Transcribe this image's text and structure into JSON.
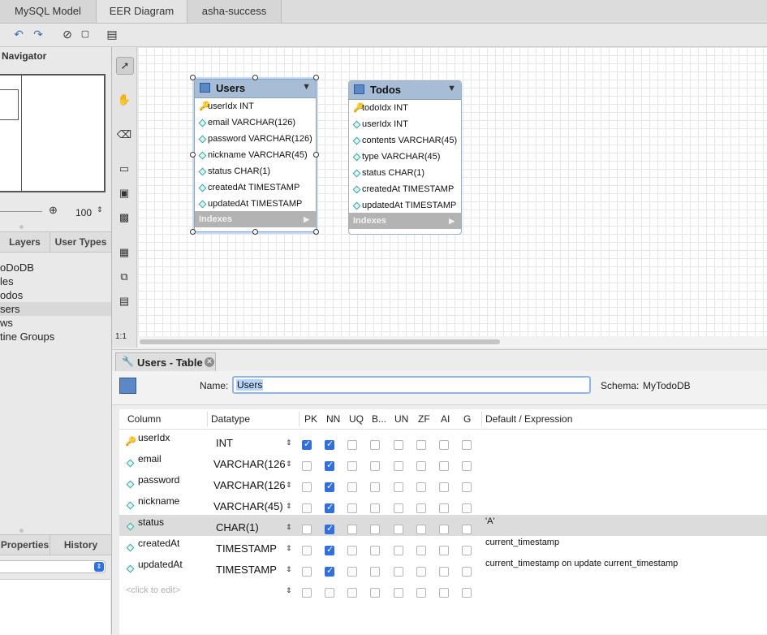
{
  "tabs": [
    "MySQL Model",
    "EER Diagram",
    "asha-success"
  ],
  "navigator": {
    "title": "Navigator",
    "zoom_value": "100"
  },
  "layer_tabs": [
    "Layers",
    "User Types"
  ],
  "tree_items": [
    "oDoDB",
    "les",
    "odos",
    "sers",
    "ws",
    "tine Groups"
  ],
  "bottom_tabs": [
    "Properties",
    "History"
  ],
  "zoom_ratio": "1:1",
  "entities": [
    {
      "name": "Users",
      "rows": [
        "userIdx INT",
        "email VARCHAR(126)",
        "password VARCHAR(126)",
        "nickname VARCHAR(45)",
        "status CHAR(1)",
        "createdAt TIMESTAMP",
        "updatedAt TIMESTAMP"
      ],
      "footer": "Indexes"
    },
    {
      "name": "Todos",
      "rows": [
        "todoIdx INT",
        "userIdx INT",
        "contents VARCHAR(45)",
        "type VARCHAR(45)",
        "status CHAR(1)",
        "createdAt TIMESTAMP",
        "updatedAt TIMESTAMP"
      ],
      "footer": "Indexes"
    }
  ],
  "editor": {
    "tab_title": "Users - Table",
    "name_label": "Name:",
    "name_value": "Users",
    "schema_label": "Schema:",
    "schema_value": "MyTodoDB"
  },
  "grid": {
    "headers": [
      "Column",
      "Datatype",
      "PK",
      "NN",
      "UQ",
      "B...",
      "UN",
      "ZF",
      "AI",
      "G",
      "Default / Expression"
    ],
    "rows": [
      {
        "name": "userIdx",
        "type": "INT",
        "default": "",
        "pk": true,
        "nn": true
      },
      {
        "name": "email",
        "type": "VARCHAR(126",
        "default": "",
        "pk": false,
        "nn": true
      },
      {
        "name": "password",
        "type": "VARCHAR(126",
        "default": "",
        "pk": false,
        "nn": true
      },
      {
        "name": "nickname",
        "type": "VARCHAR(45)",
        "default": "",
        "pk": false,
        "nn": true
      },
      {
        "name": "status",
        "type": "CHAR(1)",
        "default": "'A'",
        "pk": false,
        "nn": true
      },
      {
        "name": "createdAt",
        "type": "TIMESTAMP",
        "default": "current_timestamp",
        "pk": false,
        "nn": true
      },
      {
        "name": "updatedAt",
        "type": "TIMESTAMP",
        "default": "current_timestamp on update current_timestamp",
        "pk": false,
        "nn": true
      }
    ],
    "new_row_placeholder": "<click to edit>"
  }
}
